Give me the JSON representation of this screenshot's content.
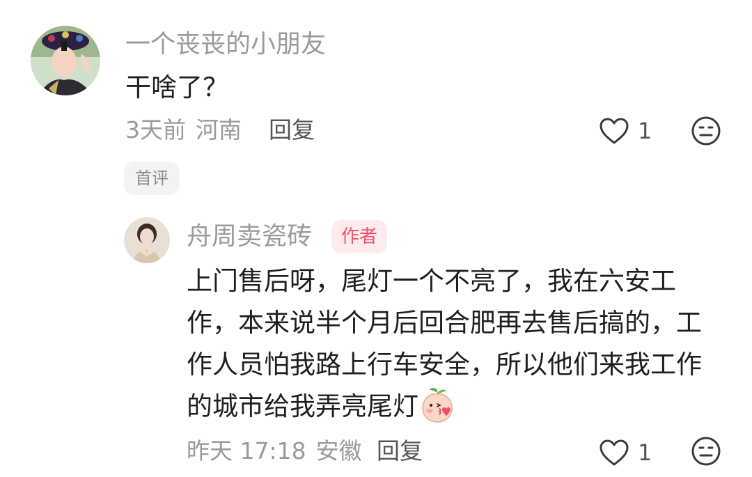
{
  "comment": {
    "username": "一个丧丧的小朋友",
    "text": "干啥了？",
    "time": "3天前",
    "location": "河南",
    "reply_label": "回复",
    "like_count": "1",
    "tag": "首评"
  },
  "reply": {
    "username": "舟周卖瓷砖",
    "author_badge": "作者",
    "lines": [
      "上门售后呀，尾灯一个不亮了，我在六安工",
      "作，本来说半个月后回合肥再去售后搞的，工",
      "作人员怕我路上行车安全，所以他们来我工作",
      "的城市给我弄亮尾灯"
    ],
    "time": "昨天 17:18",
    "location": "安徽",
    "reply_label": "回复",
    "like_count": "1"
  },
  "icons": {
    "like": "heart-outline-icon",
    "dislike": "neutral-face-icon",
    "emoji": "peach-kiss-emoji"
  },
  "colors": {
    "author_badge_text": "#f0526a",
    "author_badge_bg": "#fdebed"
  }
}
